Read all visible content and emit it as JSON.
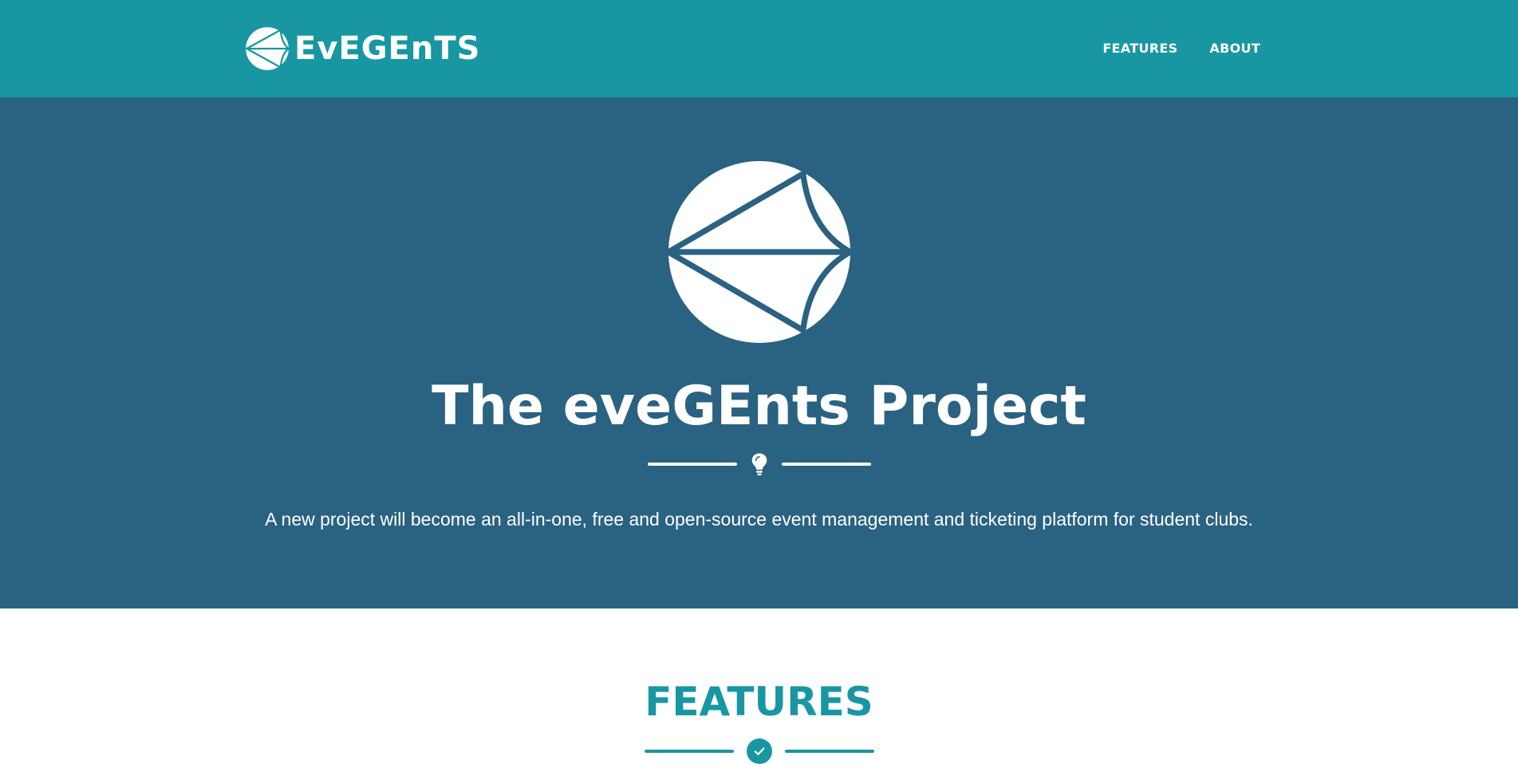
{
  "navbar": {
    "brand_text": "EvEGEnTS",
    "links": [
      {
        "label": "FEATURES"
      },
      {
        "label": "ABOUT"
      }
    ],
    "background": "#1897a3"
  },
  "hero": {
    "title": "The eveGEnts Project",
    "subtitle": "A new project will become an all-in-one, free and open-source event management and ticketing platform for student clubs.",
    "divider_icon": "lightbulb-icon",
    "background": "#2a6282"
  },
  "features": {
    "title": "FEATURES",
    "divider_icon": "check-circle-icon",
    "accent": "#1897a3"
  }
}
